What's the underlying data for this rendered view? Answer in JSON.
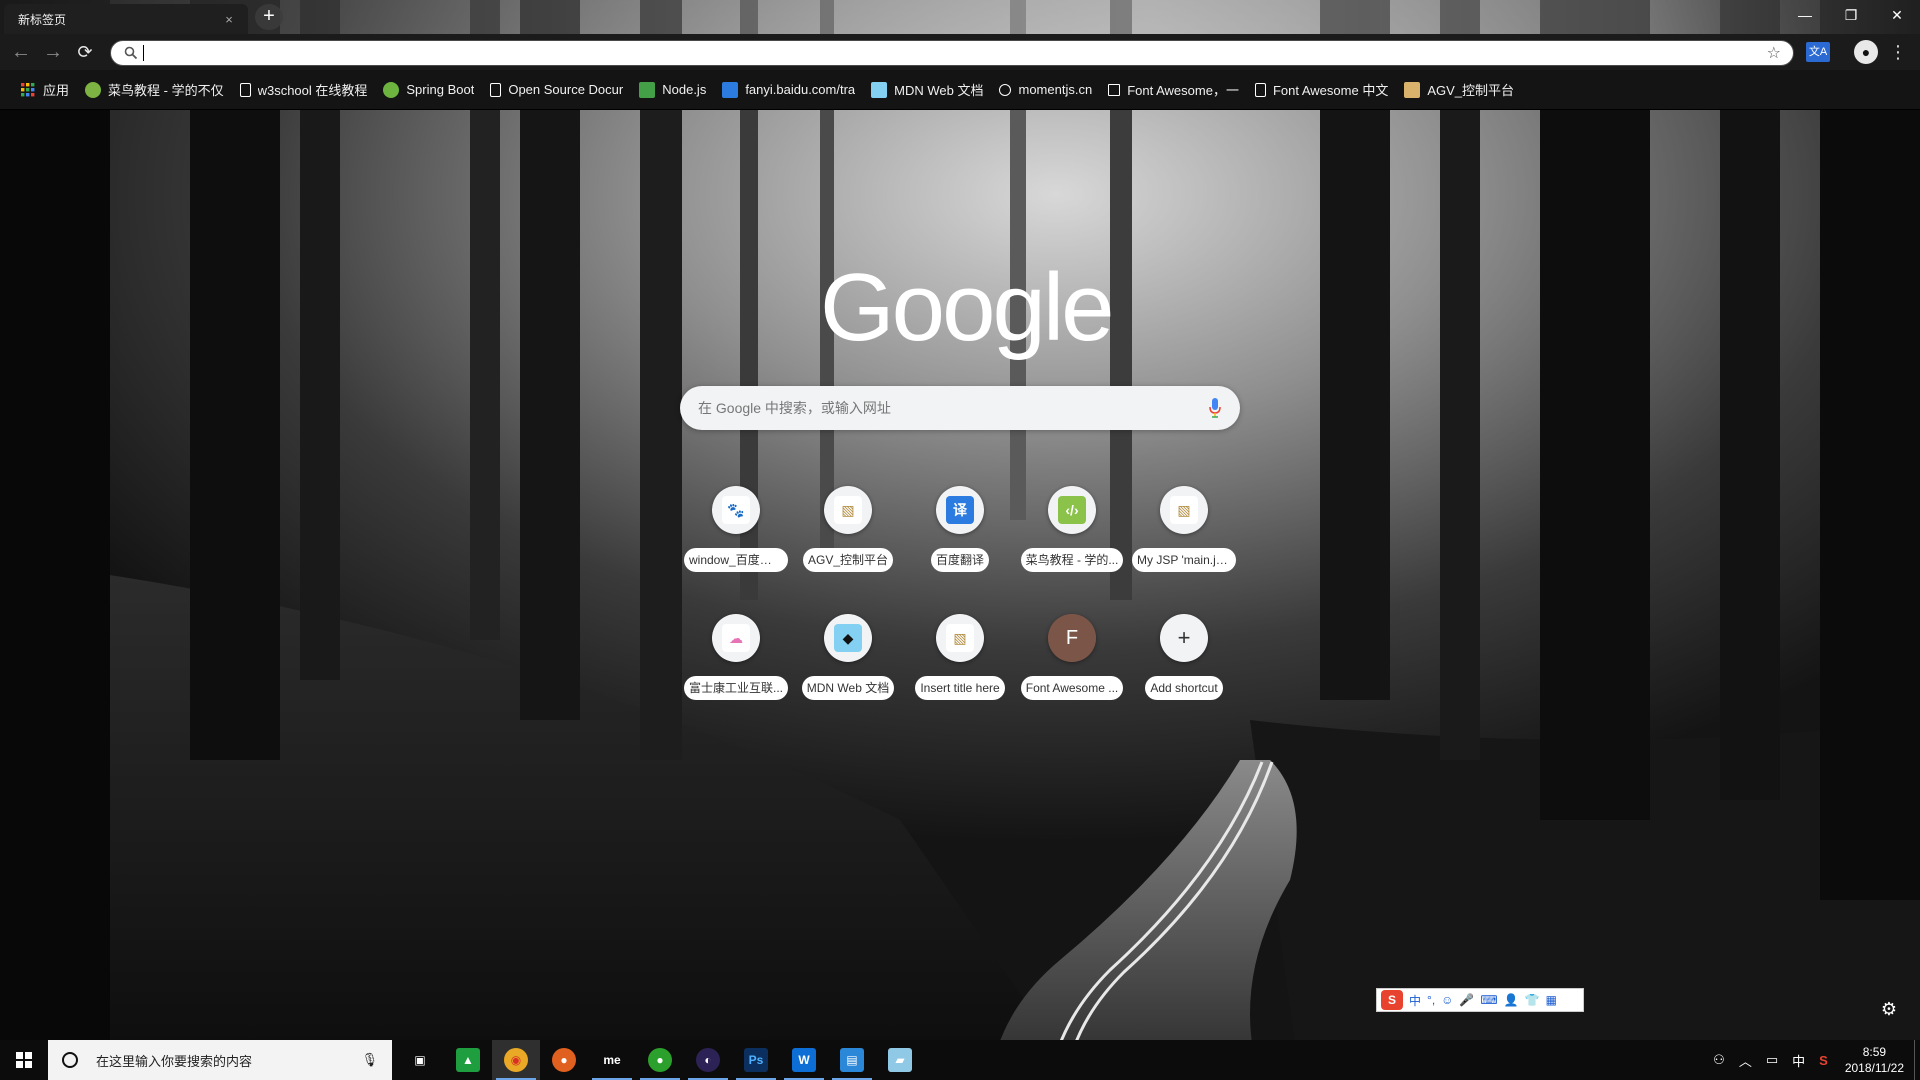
{
  "window": {
    "tab_title": "新标签页",
    "tab_close": "×",
    "new_tab": "+",
    "minimize": "—",
    "maximize": "❐",
    "close": "✕"
  },
  "toolbar": {
    "back": "←",
    "forward": "→",
    "reload": "⟳",
    "omnibox_value": "",
    "star": "☆",
    "menu": "⋮"
  },
  "bookmarks": [
    {
      "label": "应用",
      "icon": "apps-grid-icon",
      "color": "#e94235"
    },
    {
      "label": "菜鸟教程 - 学的不仅",
      "icon": "runoob-icon",
      "color": "#7cb342"
    },
    {
      "label": "w3school 在线教程",
      "icon": "page-icon",
      "color": "#ffffff"
    },
    {
      "label": "Spring Boot",
      "icon": "spring-leaf-icon",
      "color": "#6db33f"
    },
    {
      "label": "Open Source Docur",
      "icon": "page-icon",
      "color": "#ffffff"
    },
    {
      "label": "Node.js",
      "icon": "nodejs-hex-icon",
      "color": "#43a047"
    },
    {
      "label": "fanyi.baidu.com/tra",
      "icon": "baidu-translate-icon",
      "color": "#2b7be0"
    },
    {
      "label": "MDN Web 文档",
      "icon": "mdn-icon",
      "color": "#83d0f2"
    },
    {
      "label": "momentjs.cn",
      "icon": "clock-icon",
      "color": "#ffffff"
    },
    {
      "label": "Font Awesome，一",
      "icon": "flag-icon",
      "color": "#ffffff"
    },
    {
      "label": "Font Awesome 中文",
      "icon": "page-icon",
      "color": "#ffffff"
    },
    {
      "label": "AGV_控制平台",
      "icon": "image-icon",
      "color": "#d9b36c"
    }
  ],
  "ntp": {
    "logo": "Google",
    "search_placeholder": "在 Google 中搜索，或输入网址",
    "tiles_row1": [
      {
        "label": "window_百度搜索",
        "icon": "baidu-paw-icon",
        "glyph": "🐾",
        "bg": "#ffffff",
        "fg": "#2d6be4"
      },
      {
        "label": "AGV_控制平台",
        "icon": "image-icon",
        "glyph": "▧",
        "bg": "#ffffff",
        "fg": "#b08a3e"
      },
      {
        "label": "百度翻译",
        "icon": "baidu-translate-icon",
        "glyph": "译",
        "bg": "#2b7be0",
        "fg": "#ffffff"
      },
      {
        "label": "菜鸟教程 - 学的...",
        "icon": "runoob-icon",
        "glyph": "‹/›",
        "bg": "#8bc34a",
        "fg": "#ffffff"
      },
      {
        "label": "My JSP 'main.js...",
        "icon": "image-icon",
        "glyph": "▧",
        "bg": "#ffffff",
        "fg": "#b08a3e"
      }
    ],
    "tiles_row2": [
      {
        "label": "富士康工业互联...",
        "icon": "cloud-icon",
        "glyph": "☁",
        "bg": "#ffffff",
        "fg": "#e573b6"
      },
      {
        "label": "MDN Web 文档",
        "icon": "mdn-icon",
        "glyph": "◆",
        "bg": "#83d0f2",
        "fg": "#111111"
      },
      {
        "label": "Insert title here",
        "icon": "image-icon",
        "glyph": "▧",
        "bg": "#ffffff",
        "fg": "#b08a3e"
      },
      {
        "label": "Font Awesome ...",
        "icon": "letter-f-icon",
        "glyph": "F",
        "bg": "#7a5548",
        "fg": "#ffffff"
      },
      {
        "label": "Add shortcut",
        "icon": "plus-icon",
        "glyph": "+",
        "bg": "#f1f3f4",
        "fg": "#333333"
      }
    ],
    "settings": "⚙"
  },
  "ime": {
    "logo": "S",
    "items": [
      "中",
      "°,",
      "☺",
      "🎤",
      "⌨",
      "👤",
      "👕",
      "▦"
    ]
  },
  "taskbar": {
    "search_placeholder": "在这里输入你要搜索的内容",
    "apps": [
      {
        "name": "task-view-icon",
        "glyph": "▣",
        "bg": "transparent",
        "fg": "#ffffff",
        "running": false,
        "active": false
      },
      {
        "name": "excel-like-app-icon",
        "glyph": "▲",
        "bg": "#1e9e3e",
        "fg": "#ffffff",
        "running": false,
        "active": false
      },
      {
        "name": "chrome-icon",
        "glyph": "◉",
        "bg": "#e9a825",
        "fg": "#d93025",
        "running": true,
        "active": true
      },
      {
        "name": "firefox-like-icon",
        "glyph": "●",
        "bg": "#e0601f",
        "fg": "#ffffff",
        "running": false,
        "active": false
      },
      {
        "name": "me-app-icon",
        "glyph": "me",
        "bg": "transparent",
        "fg": "#ffffff",
        "running": true,
        "active": false
      },
      {
        "name": "green-fruit-icon",
        "glyph": "●",
        "bg": "#2ca02c",
        "fg": "#ffffff",
        "running": true,
        "active": false
      },
      {
        "name": "eclipse-like-icon",
        "glyph": "◐",
        "bg": "#2c2255",
        "fg": "#ffffff",
        "running": true,
        "active": false
      },
      {
        "name": "photoshop-icon",
        "glyph": "Ps",
        "bg": "#0b2f5e",
        "fg": "#4fb2ff",
        "running": true,
        "active": false
      },
      {
        "name": "webstorm-like-icon",
        "glyph": "W",
        "bg": "#0d6fd6",
        "fg": "#ffffff",
        "running": true,
        "active": false
      },
      {
        "name": "remote-desktop-icon",
        "glyph": "▤",
        "bg": "#2b88d8",
        "fg": "#ffffff",
        "running": true,
        "active": false
      },
      {
        "name": "notepad-like-icon",
        "glyph": "▰",
        "bg": "#8fc9e6",
        "fg": "#ffffff",
        "running": false,
        "active": false
      }
    ],
    "tray_people": "⚇",
    "tray_chevron": "︿",
    "tray_network": "▭",
    "tray_lang": "中",
    "tray_ime": "S",
    "time": "8:59",
    "date": "2018/11/22"
  }
}
